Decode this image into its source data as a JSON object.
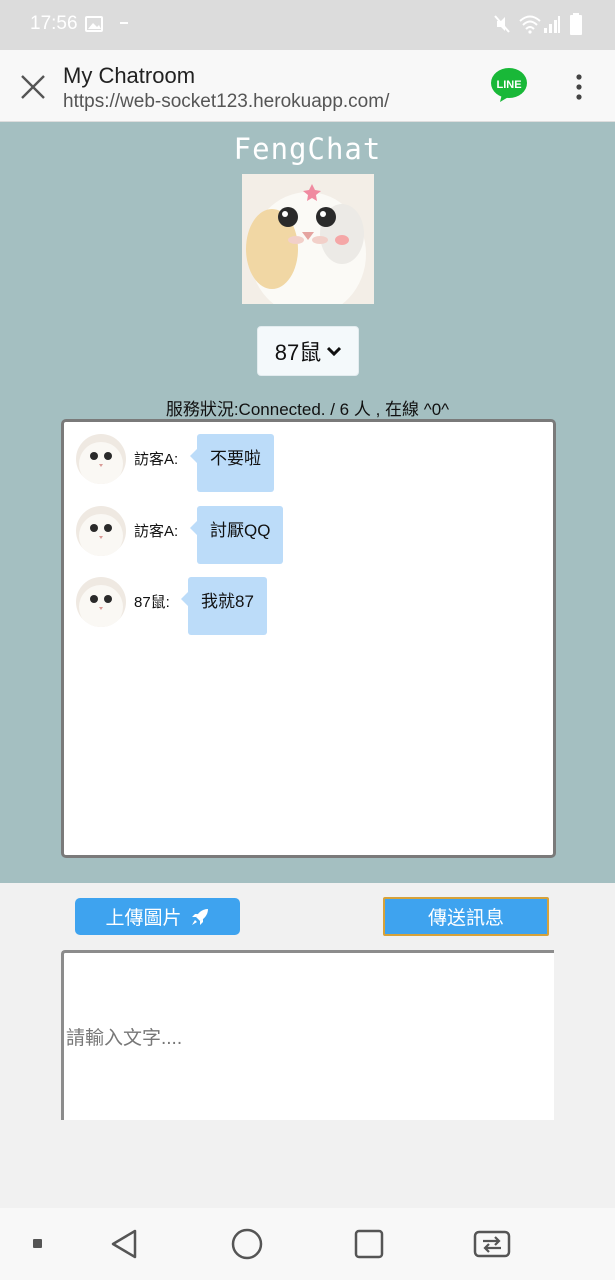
{
  "status_bar": {
    "time": "17:56",
    "icons": [
      "image-icon",
      "mute-icon",
      "wifi-icon",
      "signal-icon",
      "battery-icon"
    ]
  },
  "app_bar": {
    "title": "My Chatroom",
    "url": "https://web-socket123.herokuapp.com/",
    "line_label": "LINE",
    "line_color": "#19b838"
  },
  "chat": {
    "brand": "FengChat",
    "background_color": "#a4bfc1",
    "selected_name": "87鼠",
    "service_status": "服務狀況:Connected. / 6 人 , 在線 ^0^",
    "bubble_color": "#bcdcf9",
    "messages": [
      {
        "sender": "訪客A:",
        "text": "不要啦"
      },
      {
        "sender": "訪客A:",
        "text": "討厭QQ"
      },
      {
        "sender": "87鼠:",
        "text": "我就87"
      }
    ]
  },
  "controls": {
    "upload_label": "上傳圖片",
    "send_label": "傳送訊息",
    "input_placeholder": "請輸入文字....",
    "accent_color": "#3ea3ef"
  },
  "nav_bar": {
    "icons": [
      "back-icon",
      "home-icon",
      "recents-icon",
      "switch-app-icon"
    ]
  }
}
